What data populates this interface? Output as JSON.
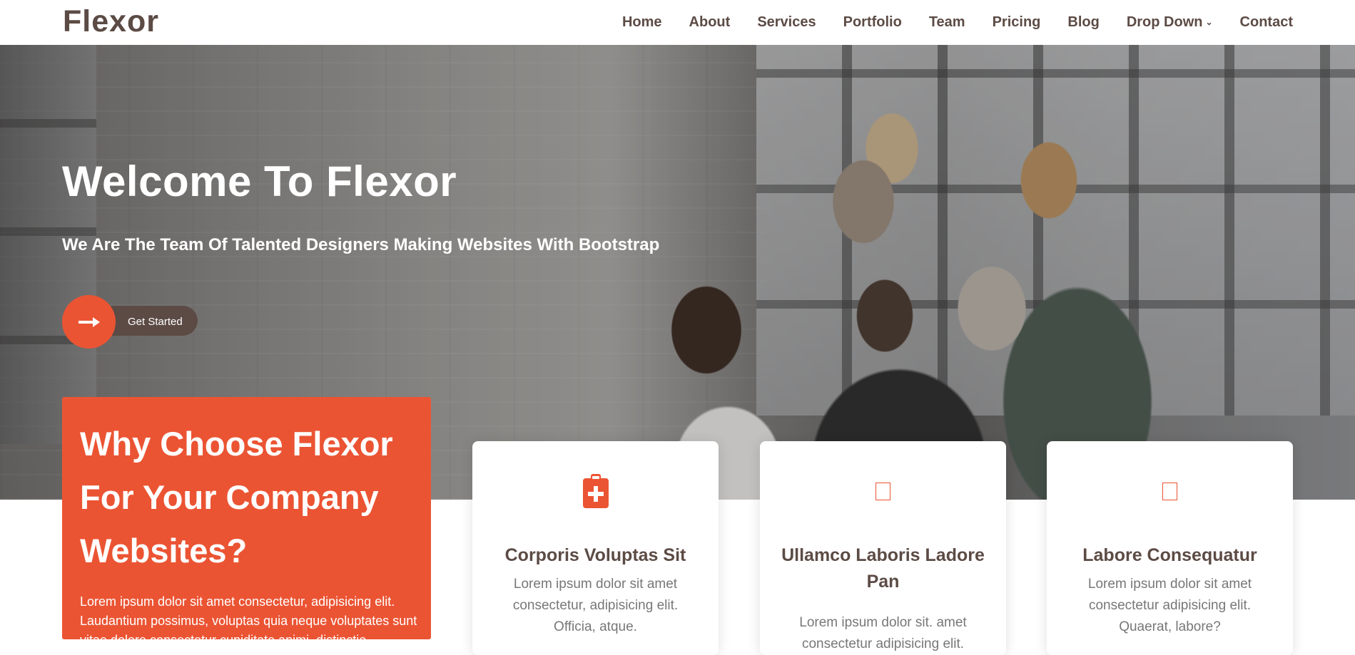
{
  "header": {
    "logo": "Flexor",
    "nav": [
      "Home",
      "About",
      "Services",
      "Portfolio",
      "Team",
      "Pricing",
      "Blog",
      "Drop Down",
      "Contact"
    ]
  },
  "hero": {
    "title": "Welcome To Flexor",
    "subtitle": "We Are The Team Of Talented Designers Making Websites With Bootstrap",
    "cta_label": "Get Started"
  },
  "why": {
    "title": "Why Choose Flexor For Your Company Websites?",
    "text": "Lorem ipsum dolor sit amet consectetur, adipisicing elit. Laudantium possimus, voluptas quia neque voluptates sunt vitae dolore consectetur cupiditate animi, distinctio."
  },
  "cards": [
    {
      "title": "Corporis Voluptas Sit",
      "text": "Lorem ipsum dolor sit amet consectetur, adipisicing elit. Officia, atque.",
      "icon": "clipboard-plus-icon"
    },
    {
      "title": "Ullamco Laboris Ladore Pan",
      "text": "Lorem ipsum dolor sit. amet consectetur adipisicing elit.",
      "icon": "missing-glyph-icon"
    },
    {
      "title": "Labore Consequatur",
      "text": "Lorem ipsum dolor sit amet consectetur adipisicing elit. Quaerat, labore?",
      "icon": "missing-glyph-icon"
    }
  ],
  "colors": {
    "accent": "#eb5433",
    "brand": "#5c4b45"
  }
}
